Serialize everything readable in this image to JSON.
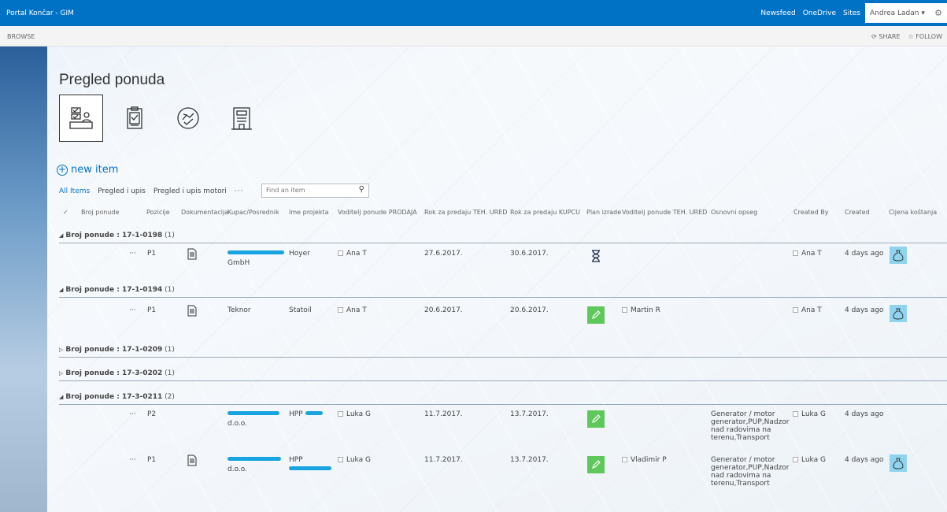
{
  "suitebar": {
    "brand": "Portal Končar - GIM",
    "links": [
      "Newsfeed",
      "OneDrive",
      "Sites"
    ],
    "user": "Andrea Ladan",
    "user_caret": "▾"
  },
  "ribbon": {
    "browse": "BROWSE",
    "share": "SHARE",
    "follow": "FOLLOW"
  },
  "page": {
    "title": "Pregled ponuda",
    "tile_icons": [
      "desk-checklist-icon",
      "clipboard-icon",
      "handshake-icon",
      "building-icon"
    ],
    "new_item": "new item",
    "views": [
      "All Items",
      "Pregled i upis",
      "Pregled i upis motori"
    ],
    "more": "···",
    "search_placeholder": "Find an item"
  },
  "columns": {
    "check": "✓",
    "broj_ponude": "Broj ponude",
    "pozicije": "Pozicije",
    "dokumentacija": "Dokumentacija",
    "kupac": "Kupac/Posrednik",
    "ime_projekta": "Ime projekta",
    "voditelj_prodaja": "Voditelj ponude PRODAJA",
    "rok_teh": "Rok za predaju TEH. URED",
    "rok_kupcu": "Rok za predaju KUPCU",
    "plan_izrade": "Plan izrade",
    "voditelj_teh": "Voditelj ponude TEH. URED",
    "osnovni_opseg": "Osnovni opseg",
    "created_by": "Created By",
    "created": "Created",
    "cijena": "Cijena koštanja"
  },
  "groups": [
    {
      "label": "Broj ponude : 17-1-0198",
      "count": "(1)",
      "expanded": true
    },
    {
      "label": "Broj ponude : 17-1-0194",
      "count": "(1)",
      "expanded": true
    },
    {
      "label": "Broj ponude : 17-1-0209",
      "count": "(1)",
      "expanded": false
    },
    {
      "label": "Broj ponude : 17-3-0202",
      "count": "(1)",
      "expanded": false
    },
    {
      "label": "Broj ponude : 17-3-0211",
      "count": "(2)",
      "expanded": true
    }
  ],
  "rows": [
    {
      "dots": "···",
      "poz": "P1",
      "kupac_line2": "GmbH",
      "projekt": "Hoyer",
      "voditelj": "Ana T",
      "rok_teh": "27.6.2017.",
      "rok_kupcu": "30.6.2017.",
      "plan": "hourglass-icon",
      "vod_teh": "",
      "opseg": "",
      "created_by": "Ana T",
      "created": "4 days ago"
    },
    {
      "dots": "···",
      "poz": "P1",
      "kupac": "Teknor",
      "projekt": "Statoil",
      "voditelj": "Ana T",
      "rok_teh": "20.6.2017.",
      "rok_kupcu": "20.6.2017.",
      "plan": "pencil-icon",
      "vod_teh": "Martin R",
      "opseg": "",
      "created_by": "Ana T",
      "created": "4 days ago"
    },
    {
      "dots": "···",
      "poz": "P2",
      "kupac_line2": "d.o.o.",
      "projekt": "HPP",
      "voditelj": "Luka G",
      "rok_teh": "11.7.2017.",
      "rok_kupcu": "13.7.2017.",
      "plan": "pencil-icon",
      "vod_teh": "",
      "opseg": "Generator / motor generator,PUP,Nadzor nad radovima na terenu,Transport",
      "created_by": "Luka G",
      "created": "4 days ago"
    },
    {
      "dots": "···",
      "poz": "P1",
      "kupac_line2": "d.o.o.",
      "projekt": "HPP",
      "voditelj": "Luka G",
      "rok_teh": "11.7.2017.",
      "rok_kupcu": "13.7.2017.",
      "plan": "pencil-icon",
      "vod_teh": "Vladimir P",
      "opseg": "Generator / motor generator,PUP,Nadzor nad radovima na terenu,Transport",
      "created_by": "Luka G",
      "created": "4 days ago"
    }
  ],
  "colors": {
    "suitebar": "#0072c6",
    "link": "#0072c6",
    "pencil_tile": "#5fc85a",
    "money_tile": "#8fd4ef",
    "redaction": "#18a4e0"
  }
}
